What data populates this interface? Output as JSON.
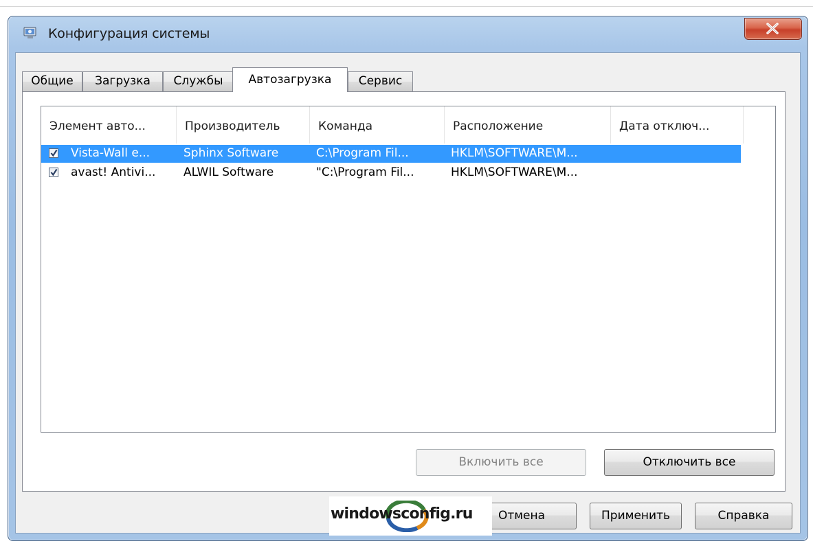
{
  "window": {
    "title": "Конфигурация системы"
  },
  "tabs": [
    {
      "label": "Общие",
      "active": false
    },
    {
      "label": "Загрузка",
      "active": false
    },
    {
      "label": "Службы",
      "active": false
    },
    {
      "label": "Автозагрузка",
      "active": true
    },
    {
      "label": "Сервис",
      "active": false
    }
  ],
  "startup_list": {
    "columns": [
      "Элемент авто...",
      "Производитель",
      "Команда",
      "Расположение",
      "Дата отключ..."
    ],
    "rows": [
      {
        "checked": true,
        "selected": true,
        "cells": [
          "Vista-Wall e...",
          "Sphinx Software",
          "C:\\Program Fil...",
          "HKLM\\SOFTWARE\\M...",
          ""
        ]
      },
      {
        "checked": true,
        "selected": false,
        "cells": [
          "avast! Antivi...",
          "ALWIL Software",
          "\"C:\\Program Fil...",
          "HKLM\\SOFTWARE\\M...",
          ""
        ]
      }
    ]
  },
  "page_buttons": {
    "enable_all": "Включить все",
    "disable_all": "Отключить все"
  },
  "dialog_buttons": {
    "cancel": "Отмена",
    "apply": "Применить",
    "help": "Справка"
  },
  "watermark": {
    "text": "windowsconfig.ru"
  },
  "colors": {
    "selection": "#3399ff",
    "frame": "#a8c6e8",
    "close_button": "#c7402a"
  }
}
